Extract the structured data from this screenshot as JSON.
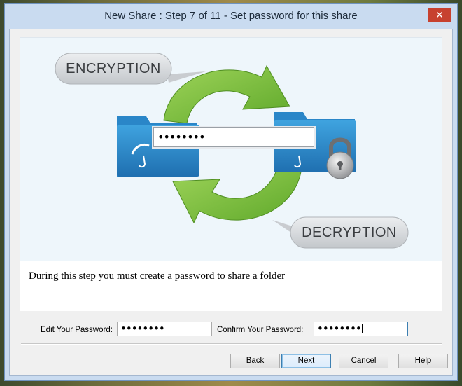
{
  "window": {
    "title": "New Share : Step 7 of 11 - Set password for this share",
    "close_icon": "close-icon"
  },
  "illustration": {
    "encryption_label": "ENCRYPTION",
    "decryption_label": "DECRYPTION",
    "password_field_value": "••••••••",
    "icons": [
      "folder-icon",
      "padlock-icon",
      "cycle-arrows-icon"
    ],
    "colors": {
      "arrow": "#7cc13b",
      "folder": "#2f8fd0",
      "label_pill": "#d9dcdf"
    }
  },
  "description": "During this step you must create a password to share a folder",
  "form": {
    "edit_label": "Edit Your Password:",
    "edit_value": "••••••••",
    "confirm_label": "Confirm Your Password:",
    "confirm_value": "••••••••"
  },
  "buttons": {
    "back": "Back",
    "next": "Next",
    "cancel": "Cancel",
    "help": "Help"
  }
}
